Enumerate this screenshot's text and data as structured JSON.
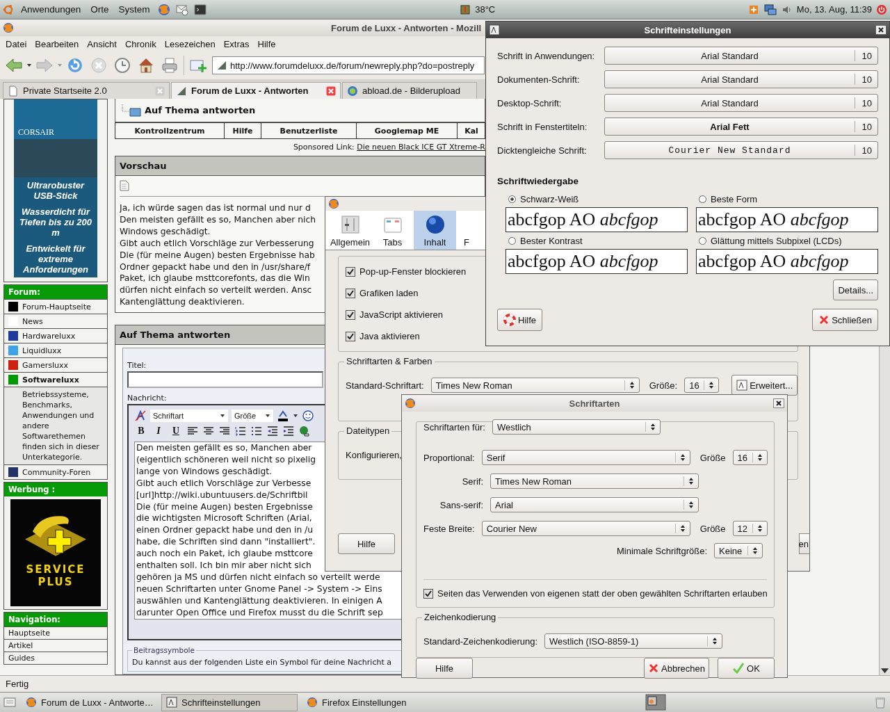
{
  "top_panel": {
    "menus": [
      "Anwendungen",
      "Orte",
      "System"
    ],
    "temperature": "38°C",
    "clock": "Mo, 13. Aug, 11:39"
  },
  "browser": {
    "title": "Forum de Luxx - Antworten - Mozill",
    "menu": [
      "Datei",
      "Bearbeiten",
      "Ansicht",
      "Chronik",
      "Lesezeichen",
      "Extras",
      "Hilfe"
    ],
    "url": "http://www.forumdeluxx.de/forum/newreply.php?do=postreply",
    "tabs": [
      {
        "label": "Private Startseite 2.0",
        "selected": false
      },
      {
        "label": "Forum de Luxx - Antworten",
        "selected": true
      },
      {
        "label": "abload.de - Bilderupload",
        "selected": false
      }
    ],
    "status": "Fertig"
  },
  "page": {
    "sidebar": {
      "brand": "CORSAIR",
      "ad_text": [
        "Ultrarobuster USB-Stick",
        "Wasserdicht für Tiefen bis zu 200 m",
        "Entwickelt für extreme Anforderungen"
      ],
      "forum_heading": "Forum:",
      "forum_items": [
        {
          "label": "Forum-Hauptseite",
          "color": "#000000",
          "selected": false
        },
        {
          "label": "News",
          "color": "#ffffff",
          "selected": false
        },
        {
          "label": "Hardwareluxx",
          "color": "#1f3c9c",
          "selected": false
        },
        {
          "label": "Liquidluxx",
          "color": "#3fa3e8",
          "selected": false
        },
        {
          "label": "Gamersluxx",
          "color": "#cc2010",
          "selected": false
        },
        {
          "label": "Softwareluxx",
          "color": "#009900",
          "selected": true
        }
      ],
      "sub_text": "Betriebssysteme, Benchmarks, Anwendungen und andere Softwarethemen finden sich in dieser Unterkategorie.",
      "community": {
        "label": "Community-Foren",
        "color": "#223366",
        "selected": false
      },
      "ad_heading": "Werbung :",
      "service_ad": [
        "SERVICE",
        "PLUS"
      ],
      "nav_heading": "Navigation:",
      "nav_items": [
        "Hauptseite",
        "Artikel",
        "Guides"
      ]
    },
    "breadcrumb_title": "Auf Thema antworten",
    "nav_links": [
      "Kontrollzentrum",
      "Hilfe",
      "Benutzerliste",
      "Googlemap ME",
      "Kal"
    ],
    "sponsored_label": "Sponsored Link:",
    "sponsored_link": "Die neuen Black ICE GT Xtreme-R",
    "preview": {
      "heading": "Vorschau",
      "lines": [
        "Ja, ich würde sagen das ist normal und nur d",
        "Den meisten gefällt es so, Manchen aber nich",
        "Windows geschädigt.",
        "Gibt auch etlich Vorschläge zur Verbesserung",
        "Die (für meine Augen) besten Ergebnisse hab",
        "Ordner gepackt habe und den in /usr/share/f",
        "Paket, ich glaube msttcorefonts, das die Win",
        "dürfen nicht einfach so verteilt werden. Ansc",
        "Kantenglättung deaktivieren."
      ]
    },
    "reply": {
      "heading": "Auf Thema antworten",
      "title_label": "Titel:",
      "message_label": "Nachricht:",
      "font_select": "Schriftart",
      "size_select": "Größe",
      "format_buttons": [
        "B",
        "I",
        "U"
      ],
      "message_lines": [
        "Den meisten gefällt es so, Manchen aber",
        "(eigentlich schöneren weil nicht so pixelig",
        "lange von Windows geschädigt.",
        "Gibt auch etlich Vorschläge zur Verbesse",
        "[url]http://wiki.ubuntuusers.de/Schriftbil",
        "Die (für meine Augen) besten Ergebnisse",
        "die wichtigsten Microsoft Schriften (Arial,",
        "einen Ordner gepackt habe und den in /u",
        "habe, die Schriften sind dann \"installiert\".",
        "auch noch ein Paket, ich glaube msttcore",
        "enthalten soll. Ich bin mir aber nicht sich",
        "gehören ja MS und dürfen nicht einfach so verteilt werde",
        "neuen Schriftarten unter Gnome Panel -> System -> Eins",
        "auswählen und Kantenglättung deaktivieren. In einigen A",
        "darunter Open Office und Firefox musst du die Schrift sep"
      ]
    },
    "icons_section": {
      "legend": "Beitragssymbole",
      "text": "Du kannst aus der folgenden Liste ein Symbol für deine Nachricht a"
    }
  },
  "preferences": {
    "tabs": [
      {
        "label": "Allgemein",
        "selected": false
      },
      {
        "label": "Tabs",
        "selected": false
      },
      {
        "label": "Inhalt",
        "selected": true
      },
      {
        "label": "F",
        "selected": false
      }
    ],
    "checkboxes": [
      {
        "label": "Pop-up-Fenster blockieren",
        "checked": true
      },
      {
        "label": "Grafiken laden",
        "checked": true
      },
      {
        "label": "JavaScript aktivieren",
        "checked": true
      },
      {
        "label": "Java aktivieren",
        "checked": true
      }
    ],
    "fonts_group": {
      "legend": "Schriftarten & Farben",
      "label": "Standard-Schriftart:",
      "value": "Times New Roman",
      "size_label": "Größe:",
      "size": "16",
      "advanced_button": "Erweitert..."
    },
    "filetypes_group": {
      "legend": "Dateitypen",
      "text": "Konfigurieren,"
    },
    "help_button": "Hilfe",
    "right_button_fragment": "en"
  },
  "font_settings": {
    "title": "Schrifteinstellungen",
    "rows": [
      {
        "label": "Schrift in Anwendungen:",
        "font": "Arial Standard",
        "size": "10",
        "kind": "regular"
      },
      {
        "label": "Dokumenten-Schrift:",
        "font": "Arial Standard",
        "size": "10",
        "kind": "regular"
      },
      {
        "label": "Desktop-Schrift:",
        "font": "Arial Standard",
        "size": "10",
        "kind": "regular"
      },
      {
        "label": "Schrift in Fenstertiteln:",
        "font": "Arial Fett",
        "size": "10",
        "kind": "bold"
      },
      {
        "label": "Dicktengleiche Schrift:",
        "font": "Courier New Standard",
        "size": "10",
        "kind": "mono"
      }
    ],
    "rendering_heading": "Schriftwiedergabe",
    "rendering_options": [
      {
        "label": "Schwarz-Weiß",
        "selected": true,
        "sample": "abcfgop AO *abcfgop*"
      },
      {
        "label": "Beste Form",
        "selected": false,
        "sample": "abcfgop AO *abcfgop*"
      },
      {
        "label": "Bester Kontrast",
        "selected": false,
        "sample": "abcfgop AO *abcfgop*"
      },
      {
        "label": "Glättung mittels Subpixel (LCDs)",
        "selected": false,
        "sample": "abcfgop AO *abcfgop*"
      }
    ],
    "details_button": "Details...",
    "help_button": "Hilfe",
    "close_button": "Schließen"
  },
  "fonts_dialog": {
    "title": "Schriftarten",
    "for_label": "Schriftarten für:",
    "for_value": "Westlich",
    "rows": [
      {
        "label": "Proportional:",
        "value": "Serif",
        "size_label": "Größe",
        "size": "16"
      },
      {
        "label": "Serif:",
        "value": "Times New Roman"
      },
      {
        "label": "Sans-serif:",
        "value": "Arial"
      },
      {
        "label": "Feste Breite:",
        "value": "Courier New",
        "size_label": "Größe",
        "size": "12"
      }
    ],
    "min_label": "Minimale Schriftgröße:",
    "min_value": "Keine",
    "allow_pages": {
      "label": "Seiten das Verwenden von eigenen statt der oben gewählten Schriftarten erlauben",
      "checked": true
    },
    "encoding_legend": "Zeichenkodierung",
    "encoding_label": "Standard-Zeichenkodierung:",
    "encoding_value": "Westlich (ISO-8859-1)",
    "help_button": "Hilfe",
    "cancel_button": "Abbrechen",
    "ok_button": "OK"
  },
  "taskbar": [
    {
      "label": "Forum de Luxx - Antworte…",
      "selected": false
    },
    {
      "label": "Schrifteinstellungen",
      "selected": true
    },
    {
      "label": "Firefox Einstellungen",
      "selected": false
    }
  ]
}
